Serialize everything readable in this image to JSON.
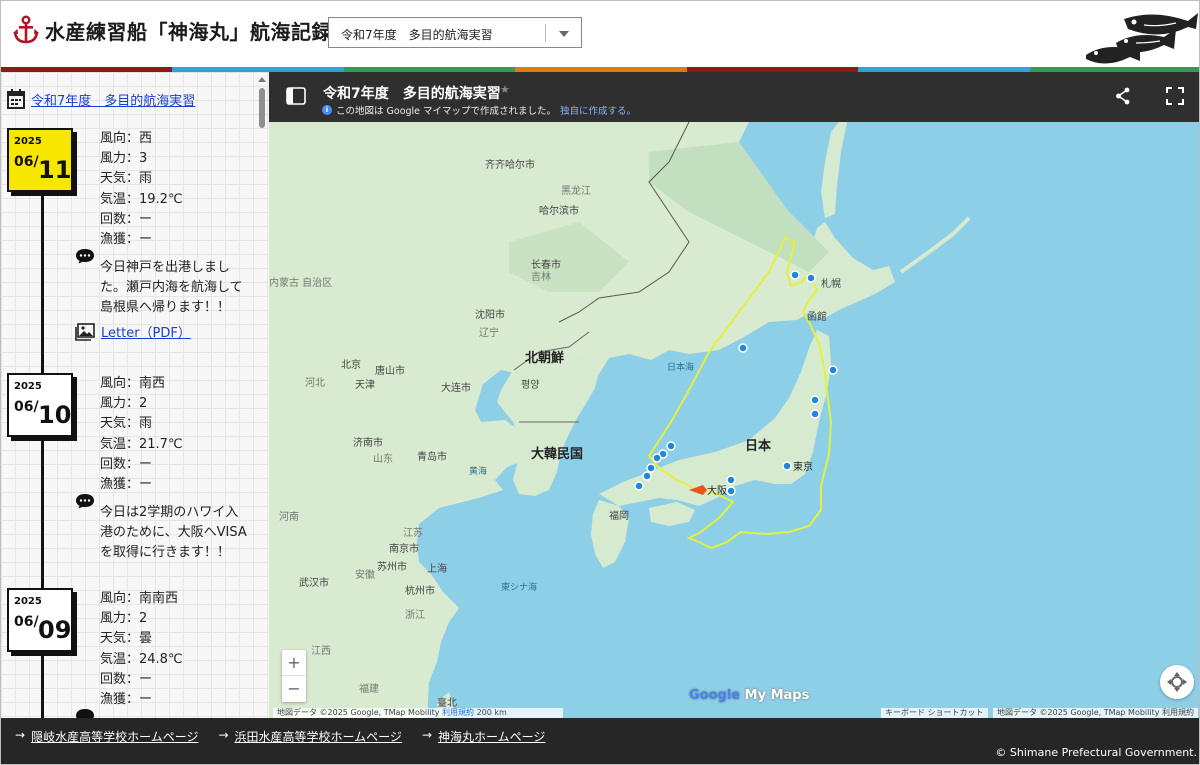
{
  "header": {
    "site_title": "水産練習船「神海丸」航海記録",
    "voyage_select": {
      "value": "令和7年度　多目的航海実習"
    }
  },
  "colors": {
    "stripe": [
      "#8b1a1a",
      "#2ea3de",
      "#2e9e54",
      "#e07a12",
      "#8b1a1a",
      "#2ea3de",
      "#2e9e54"
    ],
    "today_highlight": "#f7e600",
    "link": "#1a3fd0",
    "route": "#e5f03a",
    "ship_marker": "#e8541a",
    "waypoint": "#1f86d8"
  },
  "sidebar": {
    "title_link": "令和7年度　多目的航海実習",
    "entries": [
      {
        "year": "2025",
        "month": "06/",
        "day": "11",
        "today": true,
        "lines": [
          "風向：西",
          "風力：3",
          "天気：雨",
          "気温：19.2℃",
          "回数：ー",
          "漁獲：ー"
        ],
        "comment": "今日神戸を出港しました。瀬戸内海を航海して島根県へ帰ります！！",
        "letter": "Letter（PDF）"
      },
      {
        "year": "2025",
        "month": "06/",
        "day": "10",
        "today": false,
        "lines": [
          "風向：南西",
          "風力：2",
          "天気：雨",
          "気温：21.7℃",
          "回数：ー",
          "漁獲：ー"
        ],
        "comment": "今日は2学期のハワイ入港のために、大阪へVISAを取得に行きます！！"
      },
      {
        "year": "2025",
        "month": "06/",
        "day": "09",
        "today": false,
        "lines": [
          "風向：南南西",
          "風力：2",
          "天気：曇",
          "気温：24.8℃",
          "回数：ー",
          "漁獲：ー"
        ]
      }
    ]
  },
  "map": {
    "title": "令和7年度　多目的航海実習",
    "notice": "この地図は Google マイマップで作成されました。",
    "notice_link": "独自に作成する。",
    "labels": {
      "kitakyushu": "",
      "qiqihar": "齐齐哈尔市",
      "heilongjiang": "黑龙江",
      "harbin": "哈尔滨市",
      "jilin": "吉林",
      "changchun": "长春市",
      "liaoning": "辽宁",
      "shenyang": "沈阳市",
      "neimenggu": "内蒙古\n自治区",
      "beijing": "北京",
      "tangshan": "唐山市",
      "tianjin": "天津",
      "dalian": "大连市",
      "hebei": "河北",
      "north_korea": "北朝鮮",
      "pyongyang": "평양",
      "south_korea": "大韓民国",
      "japan": "日本",
      "sapporo": "札幌",
      "hakodate": "函館",
      "tokyo": "東京",
      "osaka": "大阪",
      "fukuoka": "福岡",
      "sea_of_japan": "日本海",
      "yellow_sea": "黄海",
      "east_china_sea": "東シナ海",
      "jinan": "济南市",
      "shandong": "山东",
      "qingdao": "青岛市",
      "henan": "河南",
      "jiangsu": "江苏",
      "nanjing": "南京市",
      "suzhou": "苏州市",
      "shanghai": "上海",
      "anhui": "安徽",
      "wuhan": "武汉市",
      "hangzhou": "杭州市",
      "zhejiang": "浙江",
      "jiangxi": "江西",
      "fujian": "福建",
      "taipei": "臺北"
    },
    "watermark": {
      "google": "Google",
      "mymaps": "My Maps"
    },
    "attribution_left": "地図データ ©2025 Google, TMap Mobility",
    "terms": "利用規約",
    "scale": "200 km",
    "keyboard": "キーボード ショートカット",
    "attribution_right": "地図データ ©2025 Google, TMap Mobility",
    "terms_right": "利用規約",
    "zoom_in": "+",
    "zoom_out": "−"
  },
  "footer": {
    "links": [
      "隠岐水産高等学校ホームページ",
      "浜田水産高等学校ホームページ",
      "神海丸ホームページ"
    ],
    "arrow": "→",
    "copyright": "© Shimane Prefectural Government."
  }
}
